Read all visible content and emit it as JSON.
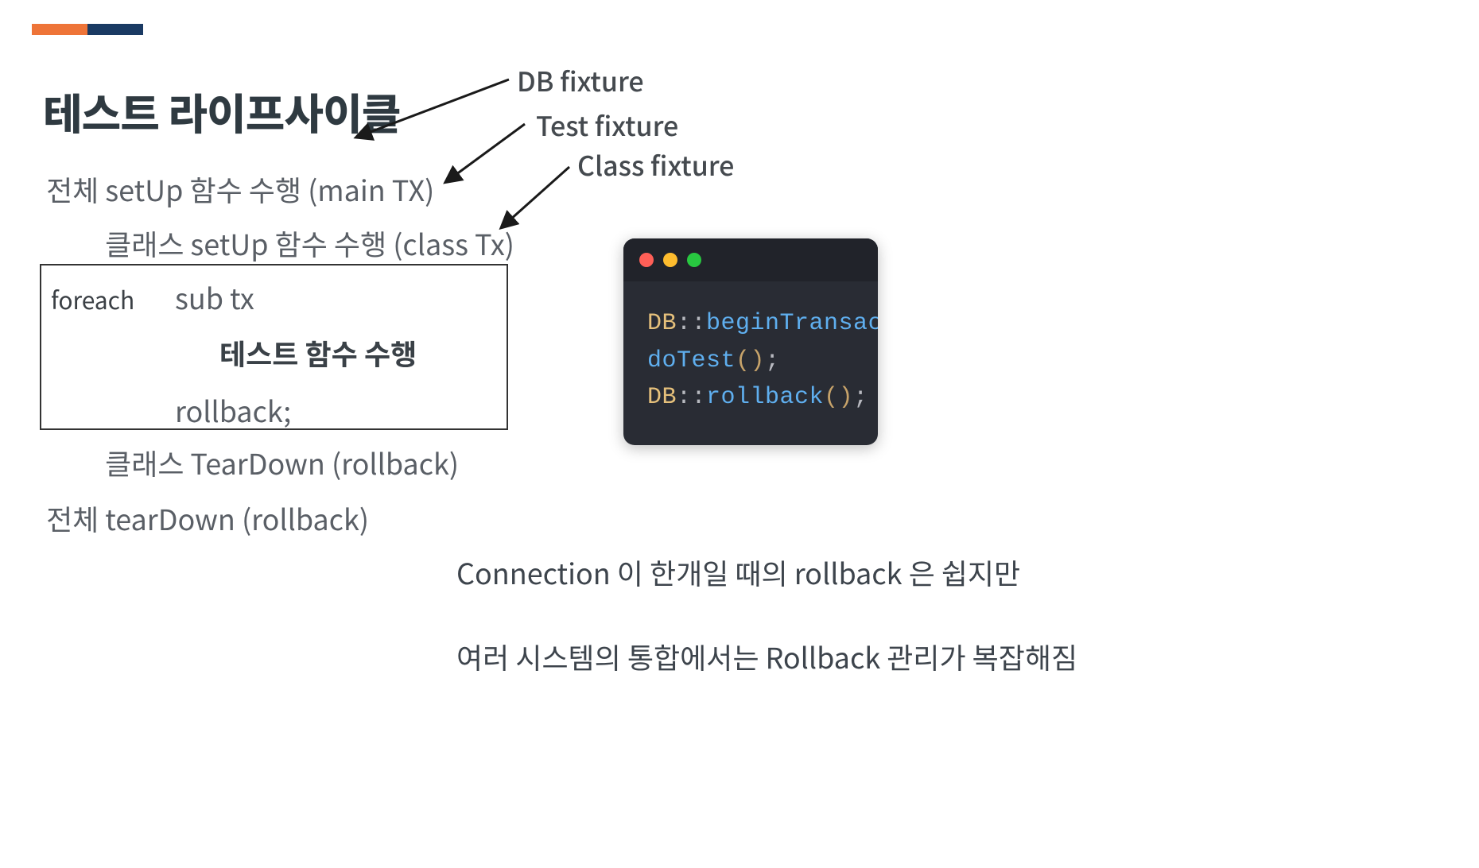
{
  "title": "테스트 라이프사이클",
  "fixtures": {
    "db": "DB fixture",
    "test": "Test fixture",
    "class": "Class fixture"
  },
  "steps": {
    "global_setup": "전체 setUp 함수 수행 (main TX)",
    "class_setup": "클래스 setUp 함수 수행 (class Tx)",
    "foreach_label": "foreach",
    "sub_tx": "sub tx",
    "test_exec": "테스트 함수 수행",
    "rollback": "rollback;",
    "class_teardown": "클래스 TearDown (rollback)",
    "global_teardown": "전체 tearDown (rollback)"
  },
  "code": {
    "line1_class": "DB",
    "line1_op": "::",
    "line1_fn": "beginTransaction",
    "line2_fn": "doTest",
    "line3_class": "DB",
    "line3_op": "::",
    "line3_fn": "rollback",
    "paren_open": "(",
    "paren_close": ")",
    "semicolon": ";"
  },
  "notes": {
    "note1": "Connection 이 한개일 때의 rollback 은 쉽지만",
    "note2": "여러 시스템의 통합에서는 Rollback 관리가 복잡해짐"
  }
}
